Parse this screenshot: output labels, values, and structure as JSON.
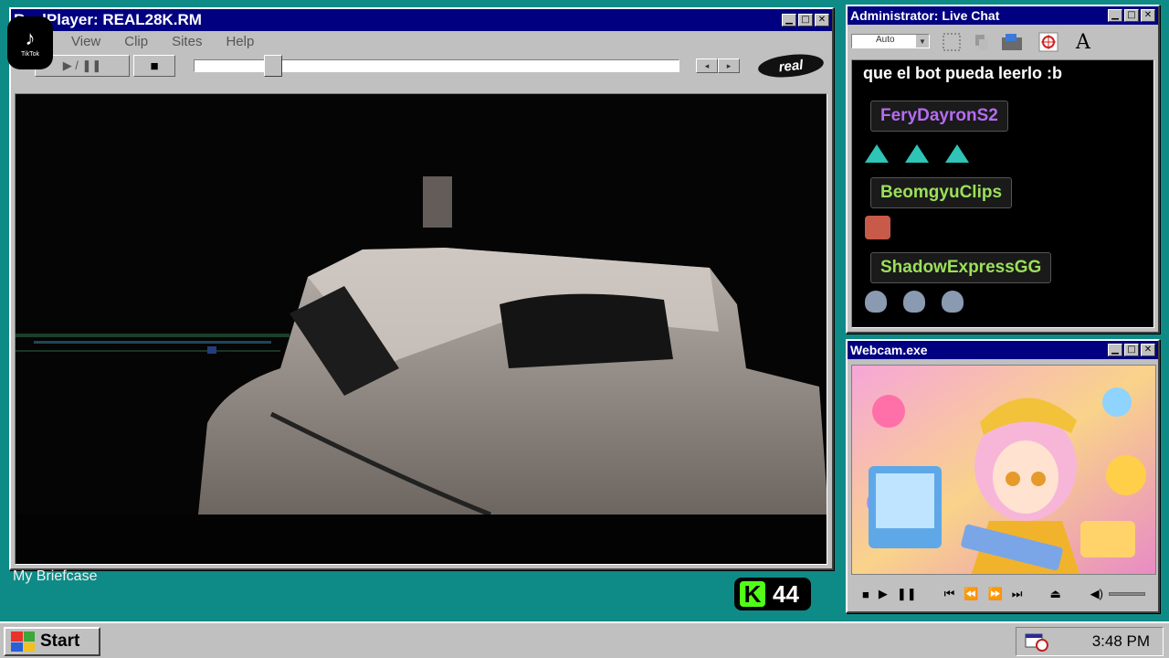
{
  "realplayer": {
    "title": "RealPlayer: REAL28K.RM",
    "menu": [
      "View",
      "Clip",
      "Sites",
      "Help"
    ],
    "play_pause_label": "▶ / ❚❚",
    "stop_label": "■",
    "prev_label": "◂",
    "next_label": "▸",
    "logo_text": "real",
    "progress": 0.15
  },
  "tiktok": {
    "glyph": "♪",
    "label": "TikTok"
  },
  "livechat": {
    "title": "Administrator: Live Chat",
    "font_select": "Auto",
    "toolbar_icons": [
      "select-icon",
      "scissors-icon",
      "paste-icon",
      "target-icon",
      "text-icon"
    ],
    "text_tool_label": "A",
    "messages": [
      {
        "type": "text",
        "text": "que el bot pueda leerlo :b"
      },
      {
        "type": "user",
        "name": "FeryDayronS2",
        "color": "#b46cf0"
      },
      {
        "type": "user",
        "name": "BeomgyuClips",
        "color": "#9be05a"
      },
      {
        "type": "user",
        "name": "ShadowExpressGG",
        "color": "#9be05a"
      }
    ]
  },
  "webcam": {
    "title": "Webcam.exe",
    "controls": [
      "■",
      "▶",
      "❚❚",
      "⏮",
      "⏪",
      "⏩",
      "⏭",
      "⏏"
    ],
    "volume_icon": "◀)"
  },
  "desktop": {
    "briefcase_label": "My Briefcase",
    "kick_letter": "K",
    "kick_count": "44"
  },
  "taskbar": {
    "start_label": "Start",
    "clock": "3:48 PM"
  },
  "window_buttons": {
    "minimize": "▁",
    "maximize": "□",
    "close": "✕"
  },
  "colors": {
    "titlebar": "#000080",
    "desktop": "#0f8b87",
    "chrome": "#c0c0c0"
  }
}
